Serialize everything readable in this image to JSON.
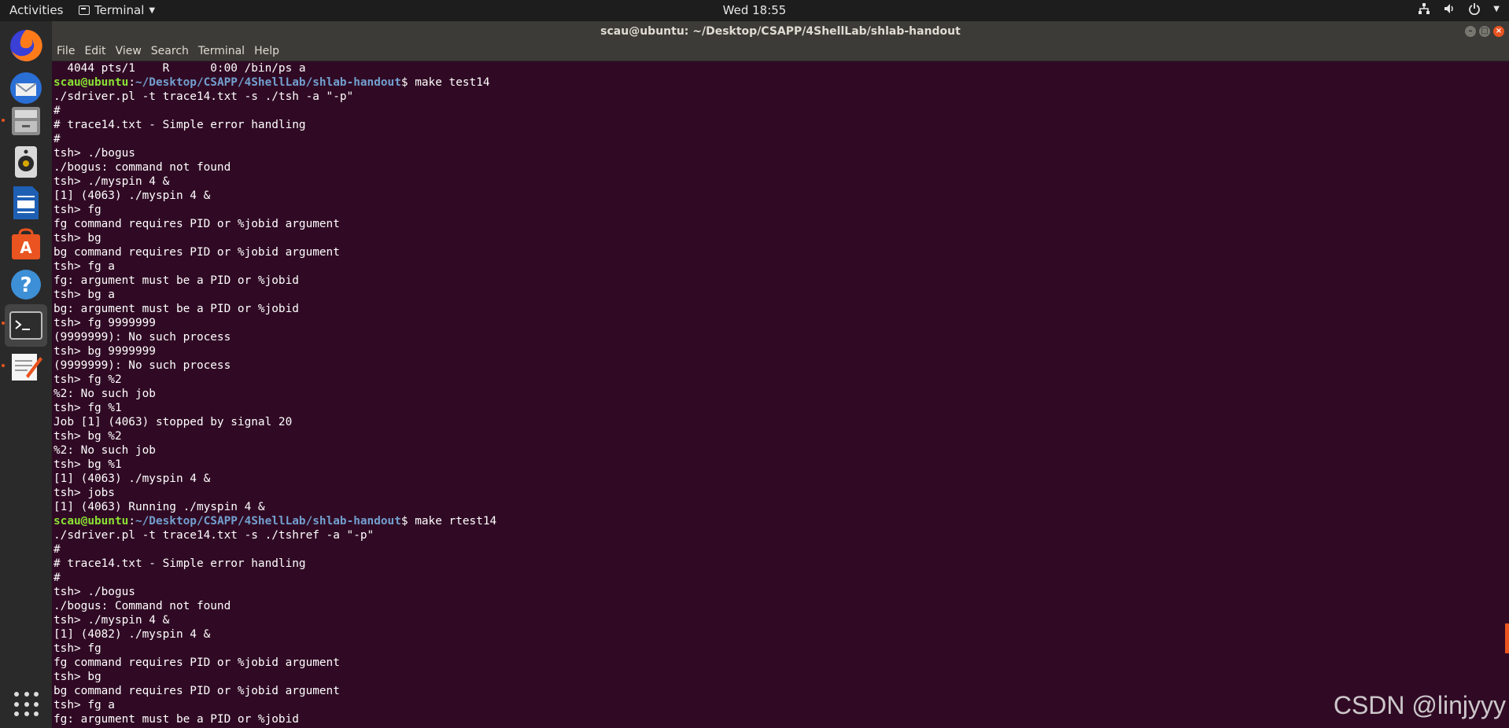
{
  "topbar": {
    "activities": "Activities",
    "app_name": "Terminal",
    "clock": "Wed 18:55"
  },
  "window": {
    "title": "scau@ubuntu: ~/Desktop/CSAPP/4ShellLab/shlab-handout",
    "menu": [
      "File",
      "Edit",
      "View",
      "Search",
      "Terminal",
      "Help"
    ]
  },
  "dock": {
    "items": [
      "firefox-icon",
      "thunderbird-icon",
      "files-icon",
      "rhythmbox-icon",
      "writer-icon",
      "software-icon",
      "help-icon",
      "terminal-icon",
      "text-editor-icon"
    ]
  },
  "terminal": {
    "lines": [
      {
        "text": "  4044 pts/1    R      0:00 /bin/ps a"
      },
      {
        "user": "scau@ubuntu",
        "path": "~/Desktop/CSAPP/4ShellLab/shlab-handout",
        "cmd": "$ make test14"
      },
      {
        "text": "./sdriver.pl -t trace14.txt -s ./tsh -a \"-p\""
      },
      {
        "text": "#"
      },
      {
        "text": "# trace14.txt - Simple error handling"
      },
      {
        "text": "#"
      },
      {
        "text": "tsh> ./bogus"
      },
      {
        "text": "./bogus: command not found"
      },
      {
        "text": "tsh> ./myspin 4 &"
      },
      {
        "text": "[1] (4063) ./myspin 4 &"
      },
      {
        "text": "tsh> fg"
      },
      {
        "text": "fg command requires PID or %jobid argument"
      },
      {
        "text": "tsh> bg"
      },
      {
        "text": "bg command requires PID or %jobid argument"
      },
      {
        "text": "tsh> fg a"
      },
      {
        "text": "fg: argument must be a PID or %jobid"
      },
      {
        "text": "tsh> bg a"
      },
      {
        "text": "bg: argument must be a PID or %jobid"
      },
      {
        "text": "tsh> fg 9999999"
      },
      {
        "text": "(9999999): No such process"
      },
      {
        "text": "tsh> bg 9999999"
      },
      {
        "text": "(9999999): No such process"
      },
      {
        "text": "tsh> fg %2"
      },
      {
        "text": "%2: No such job"
      },
      {
        "text": "tsh> fg %1"
      },
      {
        "text": "Job [1] (4063) stopped by signal 20"
      },
      {
        "text": "tsh> bg %2"
      },
      {
        "text": "%2: No such job"
      },
      {
        "text": "tsh> bg %1"
      },
      {
        "text": "[1] (4063) ./myspin 4 &"
      },
      {
        "text": "tsh> jobs"
      },
      {
        "text": "[1] (4063) Running ./myspin 4 &"
      },
      {
        "user": "scau@ubuntu",
        "path": "~/Desktop/CSAPP/4ShellLab/shlab-handout",
        "cmd": "$ make rtest14"
      },
      {
        "text": "./sdriver.pl -t trace14.txt -s ./tshref -a \"-p\""
      },
      {
        "text": "#"
      },
      {
        "text": "# trace14.txt - Simple error handling"
      },
      {
        "text": "#"
      },
      {
        "text": "tsh> ./bogus"
      },
      {
        "text": "./bogus: Command not found"
      },
      {
        "text": "tsh> ./myspin 4 &"
      },
      {
        "text": "[1] (4082) ./myspin 4 &"
      },
      {
        "text": "tsh> fg"
      },
      {
        "text": "fg command requires PID or %jobid argument"
      },
      {
        "text": "tsh> bg"
      },
      {
        "text": "bg command requires PID or %jobid argument"
      },
      {
        "text": "tsh> fg a"
      },
      {
        "text": "fg: argument must be a PID or %jobid"
      }
    ]
  },
  "watermark": "CSDN @linjyyy",
  "colors": {
    "terminal_bg": "#300a24",
    "prompt_user": "#8ae234",
    "prompt_path": "#729fcf",
    "accent": "#e95420"
  }
}
